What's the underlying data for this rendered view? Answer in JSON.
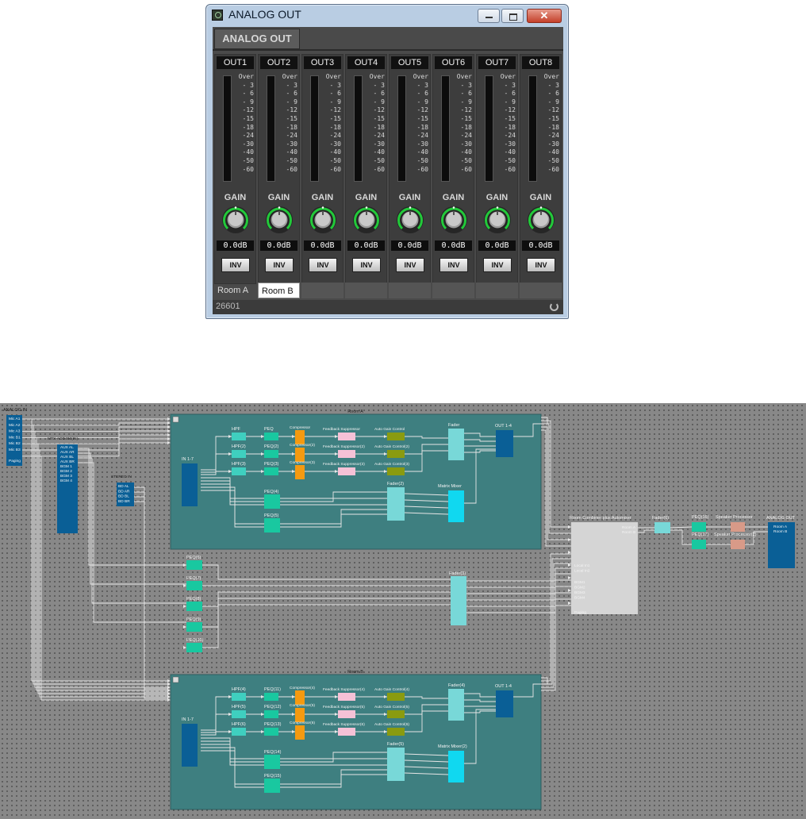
{
  "window": {
    "title": "ANALOG OUT",
    "tab": "ANALOG OUT",
    "close_glyph": "✕",
    "serial": "26601",
    "status_icon": "refresh-icon"
  },
  "channels": [
    {
      "label": "OUT1",
      "gain": "0.0dB",
      "inv": "INV",
      "name": "Room A"
    },
    {
      "label": "OUT2",
      "gain": "0.0dB",
      "inv": "INV",
      "name": "Room B"
    },
    {
      "label": "OUT3",
      "gain": "0.0dB",
      "inv": "INV",
      "name": ""
    },
    {
      "label": "OUT4",
      "gain": "0.0dB",
      "inv": "INV",
      "name": ""
    },
    {
      "label": "OUT5",
      "gain": "0.0dB",
      "inv": "INV",
      "name": ""
    },
    {
      "label": "OUT6",
      "gain": "0.0dB",
      "inv": "INV",
      "name": ""
    },
    {
      "label": "OUT7",
      "gain": "0.0dB",
      "inv": "INV",
      "name": ""
    },
    {
      "label": "OUT8",
      "gain": "0.0dB",
      "inv": "INV",
      "name": ""
    }
  ],
  "meter": {
    "gain_label": "GAIN",
    "scale": [
      "Over",
      "- 3",
      "- 6",
      "- 9",
      "-12",
      "-15",
      "-18",
      "-24",
      "-30",
      "-40",
      "-50",
      "-60"
    ]
  },
  "diagram": {
    "analog_in": {
      "title": "ANALOG IN",
      "ports": [
        "Mic A1",
        "Mic A2",
        "Mic A3",
        "Mic B1",
        "Mic B2",
        "Mic B3",
        "Paging"
      ]
    },
    "mtx": {
      "title": "MTX-AOD496(IN)",
      "ports": [
        "AUX AL",
        "AUX AR",
        "AUX BL",
        "AUX BR",
        "BGM 1",
        "BGM 2",
        "BGM 3",
        "BGM 4"
      ]
    },
    "stereo_in": {
      "title": "STEREO IN",
      "ports": [
        "BD AL",
        "BD AR",
        "BD BL",
        "BD BR"
      ]
    },
    "room_a": {
      "title": "Room A",
      "in": "IN 1-7",
      "out": "OUT 1-4",
      "hpf": [
        "HPF",
        "HPF(2)",
        "HPF(3)"
      ],
      "peq": [
        "PEQ",
        "PEQ(2)",
        "PEQ(3)",
        "PEQ(4)",
        "PEQ(5)"
      ],
      "comp": [
        "Compressor",
        "Compressor(2)",
        "Compressor(3)"
      ],
      "fbs": [
        "Feedback Suppressor",
        "Feedback Suppressor(2)",
        "Feedback Suppressor(3)"
      ],
      "agc": [
        "Auto Gain Control",
        "Auto Gain Control(2)",
        "Auto Gain Control(3)"
      ],
      "fader": "Fader",
      "fader2": "Fader(2)",
      "matrix": "Matrix Mixer"
    },
    "room_b": {
      "title": "Room B",
      "in": "IN 1-7",
      "out": "OUT 1-4",
      "hpf": [
        "HPF(4)",
        "HPF(5)",
        "HPF(6)"
      ],
      "peq": [
        "PEQ(11)",
        "PEQ(12)",
        "PEQ(13)",
        "PEQ(14)",
        "PEQ(15)"
      ],
      "comp": [
        "Compressor(4)",
        "Compressor(5)",
        "Compressor(6)"
      ],
      "fbs": [
        "Feedback Suppressor(4)",
        "Feedback Suppressor(5)",
        "Feedback Suppressor(6)"
      ],
      "agc": [
        "Auto Gain Control(4)",
        "Auto Gain Control(5)",
        "Auto Gain Control(6)"
      ],
      "fader": "Fader(4)",
      "fader2": "Fader(5)",
      "matrix": "Matrix Mixer(2)"
    },
    "mid_peq": [
      "PEQ(6)",
      "PEQ(7)",
      "PEQ(8)",
      "PEQ(9)",
      "PEQ(10)"
    ],
    "fader3": "Fader(3)",
    "combiner": {
      "title": "Room Combiner plus Automixer",
      "out_ports": [
        "Room A",
        "Room B"
      ],
      "in_ports": [
        "Local In1",
        "Local In2",
        "BGM1",
        "BGM2",
        "BGM3",
        "BGM4",
        "Paging"
      ]
    },
    "fader6": "Fader(6)",
    "peq_out": [
      "PEQ(16)",
      "PEQ(17)"
    ],
    "speaker": [
      "Speaker Processor",
      "Speaker Processor(2)"
    ],
    "analog_out": {
      "title": "ANALOG OUT",
      "ports": [
        "Room A",
        "Room B"
      ]
    },
    "colors": {
      "room_panel": "#3e7f80",
      "io_block": "#0a5f96",
      "peq": "#19c8a0",
      "hpf": "#3fcfbf",
      "comp": "#f59a10",
      "fbs": "#f5c1d6",
      "agc": "#8a9b10",
      "fader": "#78d8d8",
      "matrix": "#10d8f0",
      "speaker": "#d89a88",
      "combiner": "#d5d5d5",
      "wire": "#e6e6e6"
    }
  }
}
